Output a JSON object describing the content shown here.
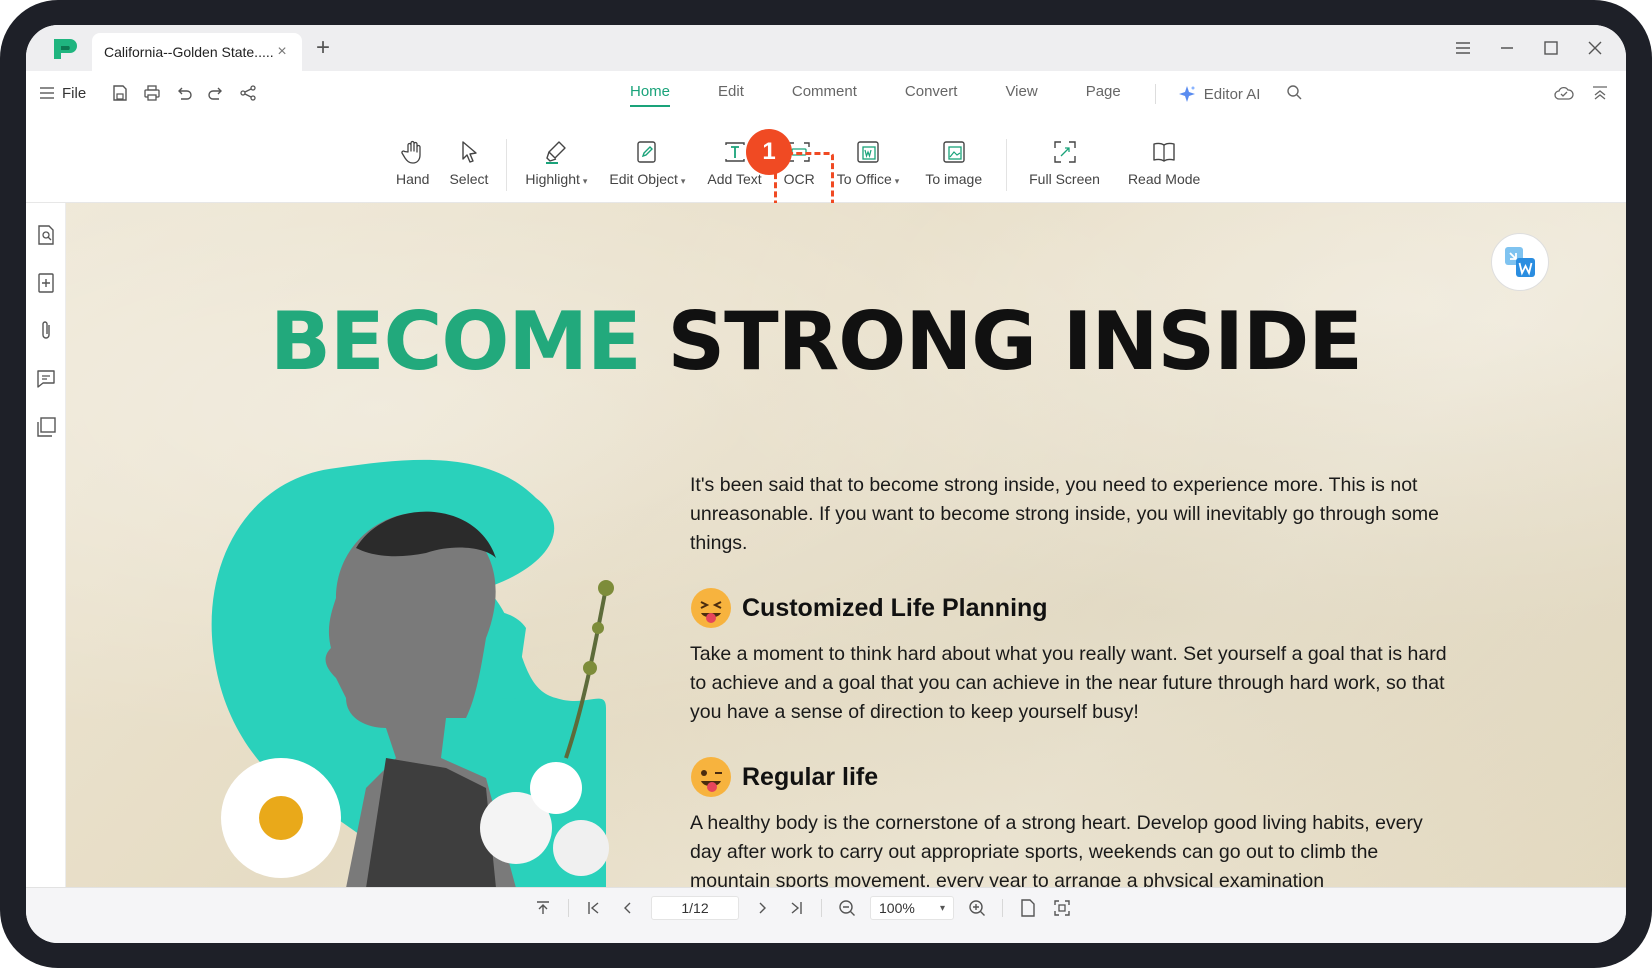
{
  "window": {
    "tab_title": "California--Golden State......",
    "new_tab": "+",
    "tab_close": "×"
  },
  "menu": {
    "file_label": "File",
    "tabs": [
      {
        "label": "Home",
        "active": true
      },
      {
        "label": "Edit",
        "active": false
      },
      {
        "label": "Comment",
        "active": false
      },
      {
        "label": "Convert",
        "active": false
      },
      {
        "label": "View",
        "active": false
      },
      {
        "label": "Page",
        "active": false
      }
    ],
    "editor_ai": "Editor AI"
  },
  "toolbar": {
    "hand": "Hand",
    "select": "Select",
    "highlight": "Highlight",
    "edit_object": "Edit Object",
    "add_text": "Add Text",
    "ocr": "OCR",
    "to_office": "To Office",
    "to_image": "To image",
    "full_screen": "Full Screen",
    "read_mode": "Read Mode",
    "dropdown_glyph": "▾"
  },
  "annotation": {
    "step_number": "1",
    "highlight_color": "#f04a23"
  },
  "document": {
    "headline_green": "BECOME",
    "headline_dark": "STRONG INSIDE",
    "intro": "It's been said that to become strong inside, you need to experience more. This is not unreasonable. If you want to become strong inside, you will inevitably go through some things.",
    "section1_title": "Customized Life Planning",
    "section1_body": "Take a moment to think hard about what you really want. Set yourself a goal that is hard to achieve and a goal that you can achieve in the near future through hard work, so that you have a sense of direction to keep yourself busy!",
    "section2_title": "Regular life",
    "section2_body": "A healthy body is the cornerstone of a strong heart. Develop good living habits, every day after work to carry out appropriate sports, weekends can go out to climb the mountain sports movement, every year to arrange a physical examination"
  },
  "status": {
    "page_indicator": "1/12",
    "zoom": "100%",
    "zoom_caret": "▾"
  },
  "colors": {
    "accent": "#1aa37a",
    "headline_green": "#22a97c",
    "teal_shape": "#2ad1bb",
    "badge": "#f04a23"
  }
}
